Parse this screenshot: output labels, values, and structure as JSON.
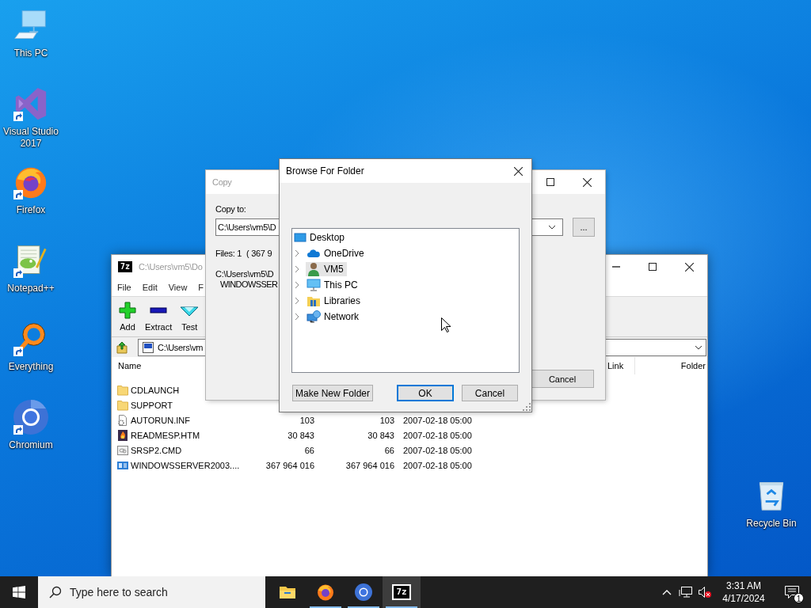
{
  "desktop_icons": [
    {
      "label": "This PC",
      "kind": "computer",
      "shortcut": false
    },
    {
      "label": "Visual Studio 2017",
      "kind": "visual-studio",
      "shortcut": true
    },
    {
      "label": "Firefox",
      "kind": "firefox",
      "shortcut": true
    },
    {
      "label": "Notepad++",
      "kind": "notepad",
      "shortcut": true
    },
    {
      "label": "Everything",
      "kind": "everything",
      "shortcut": true
    },
    {
      "label": "Chromium",
      "kind": "chromium",
      "shortcut": true
    }
  ],
  "recycle_bin": {
    "label": "Recycle Bin",
    "kind": "recycle-bin",
    "shortcut": false
  },
  "archive_window": {
    "icon_text": "7z",
    "title": "C:\\Users\\vm5\\Do",
    "active": false,
    "menu": [
      "File",
      "Edit",
      "View",
      "F"
    ],
    "toolbar": [
      {
        "label": "Add",
        "kind": "add"
      },
      {
        "label": "Extract",
        "kind": "extract"
      },
      {
        "label": "Test",
        "kind": "test"
      }
    ],
    "address": "C:\\Users\\vm",
    "columns": [
      "Name",
      "Link",
      "Folder"
    ],
    "rows": [
      {
        "name": "CDLAUNCH",
        "kind": "folder"
      },
      {
        "name": "SUPPORT",
        "kind": "folder"
      },
      {
        "name": "AUTORUN.INF",
        "kind": "settings-file",
        "size": "103",
        "packed_size": "103",
        "modified": "2007-02-18 05:00"
      },
      {
        "name": "READMESP.HTM",
        "kind": "web-page",
        "size": "30 843",
        "packed_size": "30 843",
        "modified": "2007-02-18 05:00"
      },
      {
        "name": "SRSP2.CMD",
        "kind": "script",
        "size": "66",
        "packed_size": "66",
        "modified": "2007-02-18 05:00"
      },
      {
        "name": "WINDOWSSERVER2003....",
        "kind": "disk-image",
        "size": "367 964 016",
        "packed_size": "367 964 016",
        "modified": "2007-02-18 05:00"
      }
    ]
  },
  "copy_dialog": {
    "title": "Copy",
    "active": false,
    "copy_to_label": "Copy to:",
    "copy_to_value": "C:\\Users\\vm5\\D",
    "browse_button": "...",
    "files": "Files: 1",
    "size": "( 367 9",
    "source_path": "C:\\Users\\vm5\\D",
    "source_name": "WINDOWSSER",
    "cancel_button": "Cancel"
  },
  "browse_dialog": {
    "title": "Browse For Folder",
    "active": true,
    "tree": {
      "label": "Desktop",
      "kind": "desktop",
      "selected": false,
      "children": [
        {
          "label": "OneDrive",
          "kind": "cloud",
          "expanded": false,
          "selected": false
        },
        {
          "label": "VM5",
          "kind": "user",
          "expanded": false,
          "selected": true
        },
        {
          "label": "This PC",
          "kind": "computer",
          "expanded": false,
          "selected": false
        },
        {
          "label": "Libraries",
          "kind": "library",
          "expanded": false,
          "selected": false
        },
        {
          "label": "Network",
          "kind": "network",
          "expanded": false,
          "selected": false
        }
      ]
    },
    "buttons": [
      {
        "label": "Make New Folder",
        "default": false
      },
      {
        "label": "OK",
        "default": true
      },
      {
        "label": "Cancel",
        "default": false
      }
    ]
  },
  "taskbar": {
    "search_placeholder": "Type here to search",
    "apps": [
      {
        "kind": "file-explorer",
        "running": false,
        "active": false
      },
      {
        "kind": "firefox",
        "running": true,
        "active": false
      },
      {
        "kind": "chromium",
        "running": true,
        "active": false
      },
      {
        "kind": "archiver",
        "label": "7z",
        "running": true,
        "active": true
      }
    ],
    "time": "3:31 AM",
    "date": "4/17/2024",
    "notification_count": "1"
  }
}
